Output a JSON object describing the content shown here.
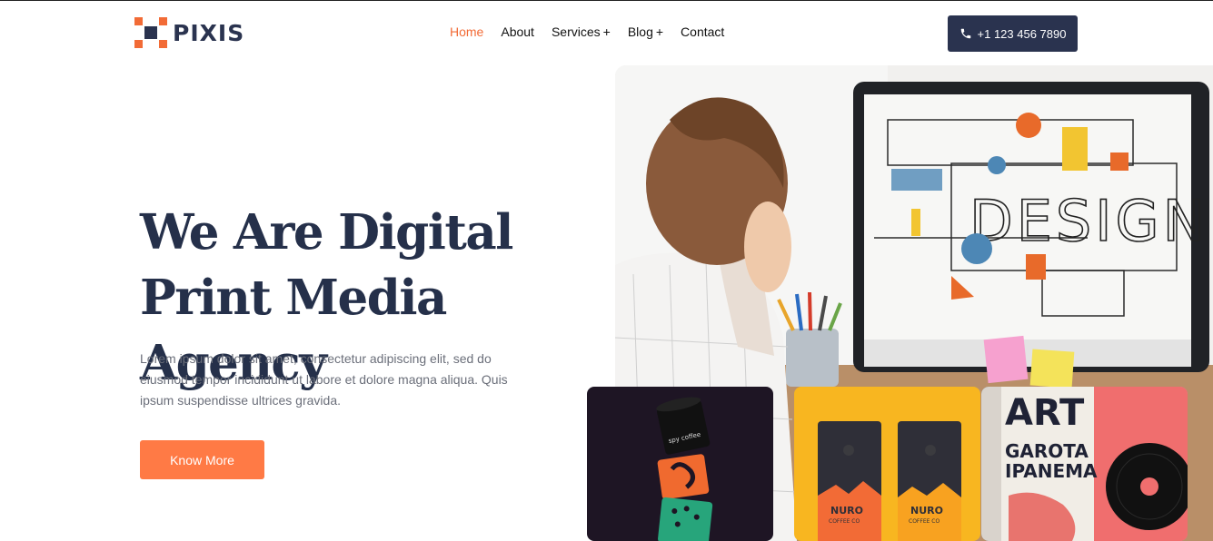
{
  "brand": {
    "name": "PIXIS"
  },
  "nav": {
    "items": [
      {
        "label": "Home",
        "active": true
      },
      {
        "label": "About"
      },
      {
        "label": "Services",
        "has_submenu": true,
        "submenu_icon": "+"
      },
      {
        "label": "Blog",
        "has_submenu": true,
        "submenu_icon": "+"
      },
      {
        "label": "Contact"
      }
    ]
  },
  "phone": {
    "number": "+1 123 456 7890",
    "icon": "phone-icon"
  },
  "hero": {
    "title_line1": "We Are Digital",
    "title_line2": "Print Media Agency",
    "text": "Lorem ipsum dolor sit amet, consectetur adipiscing elit, sed do eiusmod tempor incididunt ut labore et dolore magna aliqua. Quis ipsum suspendisse ultrices gravida.",
    "button_label": "Know More"
  },
  "monitor": {
    "screen_text": "DESIGN"
  },
  "products": {
    "cups_text": "spy coffee",
    "bag_brand": "NURO",
    "bag_sub": "COFFEE CO",
    "poster_text": "ART GAROTA IPANEMA"
  },
  "colors": {
    "accent": "#f26b36",
    "button": "#ff7a45",
    "dark": "#2a334f"
  }
}
